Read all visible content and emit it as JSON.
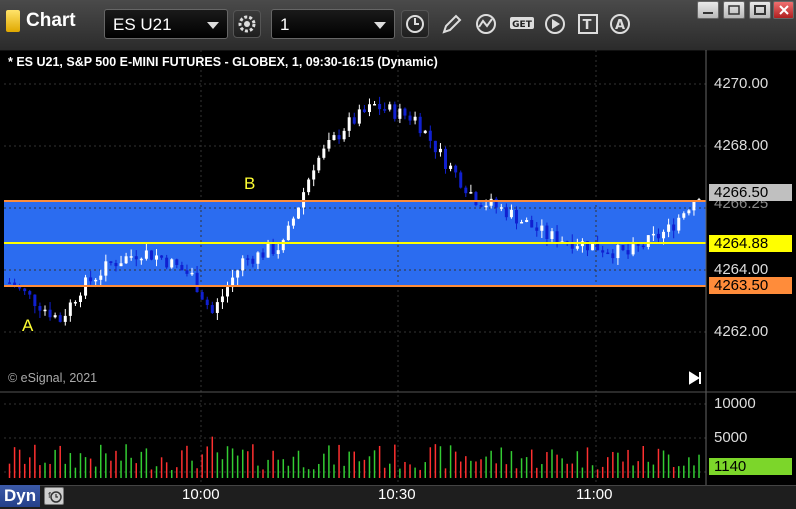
{
  "app": {
    "title": "Chart"
  },
  "toolbar": {
    "symbol": "ES U21",
    "interval": "1"
  },
  "chart": {
    "header": "* ES U21, S&P 500 E-MINI FUTURES - GLOBEX, 1, 09:30-16:15 (Dynamic)",
    "copyright": "© eSignal, 2021",
    "price_axis": [
      "4270.00",
      "4268.00",
      "4264.00",
      "4262.00"
    ],
    "price_partial": "4266.25",
    "volume_axis": [
      "10000",
      "5000"
    ],
    "time_axis": [
      "10:00",
      "10:30",
      "11:00"
    ],
    "annotations": {
      "a": "A",
      "b": "B"
    },
    "price_tags": {
      "last": {
        "value": "4266.50",
        "color": "#c0c0c0"
      },
      "mid": {
        "value": "4264.88",
        "color": "#ffff00"
      },
      "low": {
        "value": "4263.50",
        "color": "#ff8c3a"
      },
      "volume": {
        "value": "1140",
        "color": "#7cd62a"
      }
    },
    "range_fill_color": "#2b6cf0",
    "up_color": "#ffffff",
    "down_color": "#1020d0",
    "vol_up_color": "#33cc33",
    "vol_down_color": "#ff3030"
  },
  "status": {
    "mode": "Dyn"
  }
}
